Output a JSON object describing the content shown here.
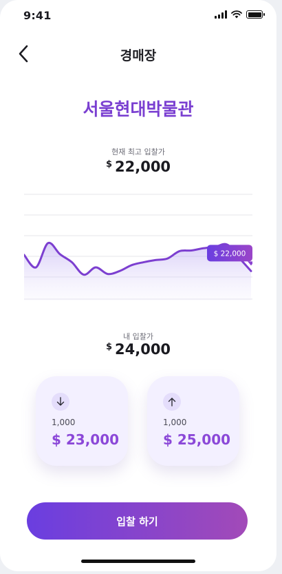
{
  "status_bar": {
    "time": "9:41"
  },
  "nav": {
    "title": "경매장",
    "back_icon": "chevron-left-icon"
  },
  "museum_name": "서울현대박물관",
  "current_bid": {
    "label": "현재 최고 입찰가",
    "currency": "$",
    "amount": "22,000"
  },
  "chart_data": {
    "type": "area",
    "tooltip": "$ 22,000",
    "y": [
      62,
      45,
      78,
      63,
      52,
      35,
      45,
      36,
      40,
      48,
      52,
      55,
      57,
      67,
      68,
      71,
      73,
      76,
      58,
      40
    ],
    "ylim": [
      0,
      150
    ],
    "grid": true,
    "line_color": "#7c3fd0"
  },
  "my_bid": {
    "label": "내 입찰가",
    "currency": "$",
    "amount": "24,000"
  },
  "decrease_card": {
    "icon": "arrow-down-icon",
    "step": "1,000",
    "value": "$ 23,000"
  },
  "increase_card": {
    "icon": "arrow-up-icon",
    "step": "1,000",
    "value": "$ 25,000"
  },
  "submit_button": {
    "label": "입찰 하기"
  },
  "colors": {
    "accent": "#7a3fd1",
    "card_bg": "#f3f0ff",
    "button_start": "#6a3ee0",
    "button_end": "#a24ab8"
  }
}
